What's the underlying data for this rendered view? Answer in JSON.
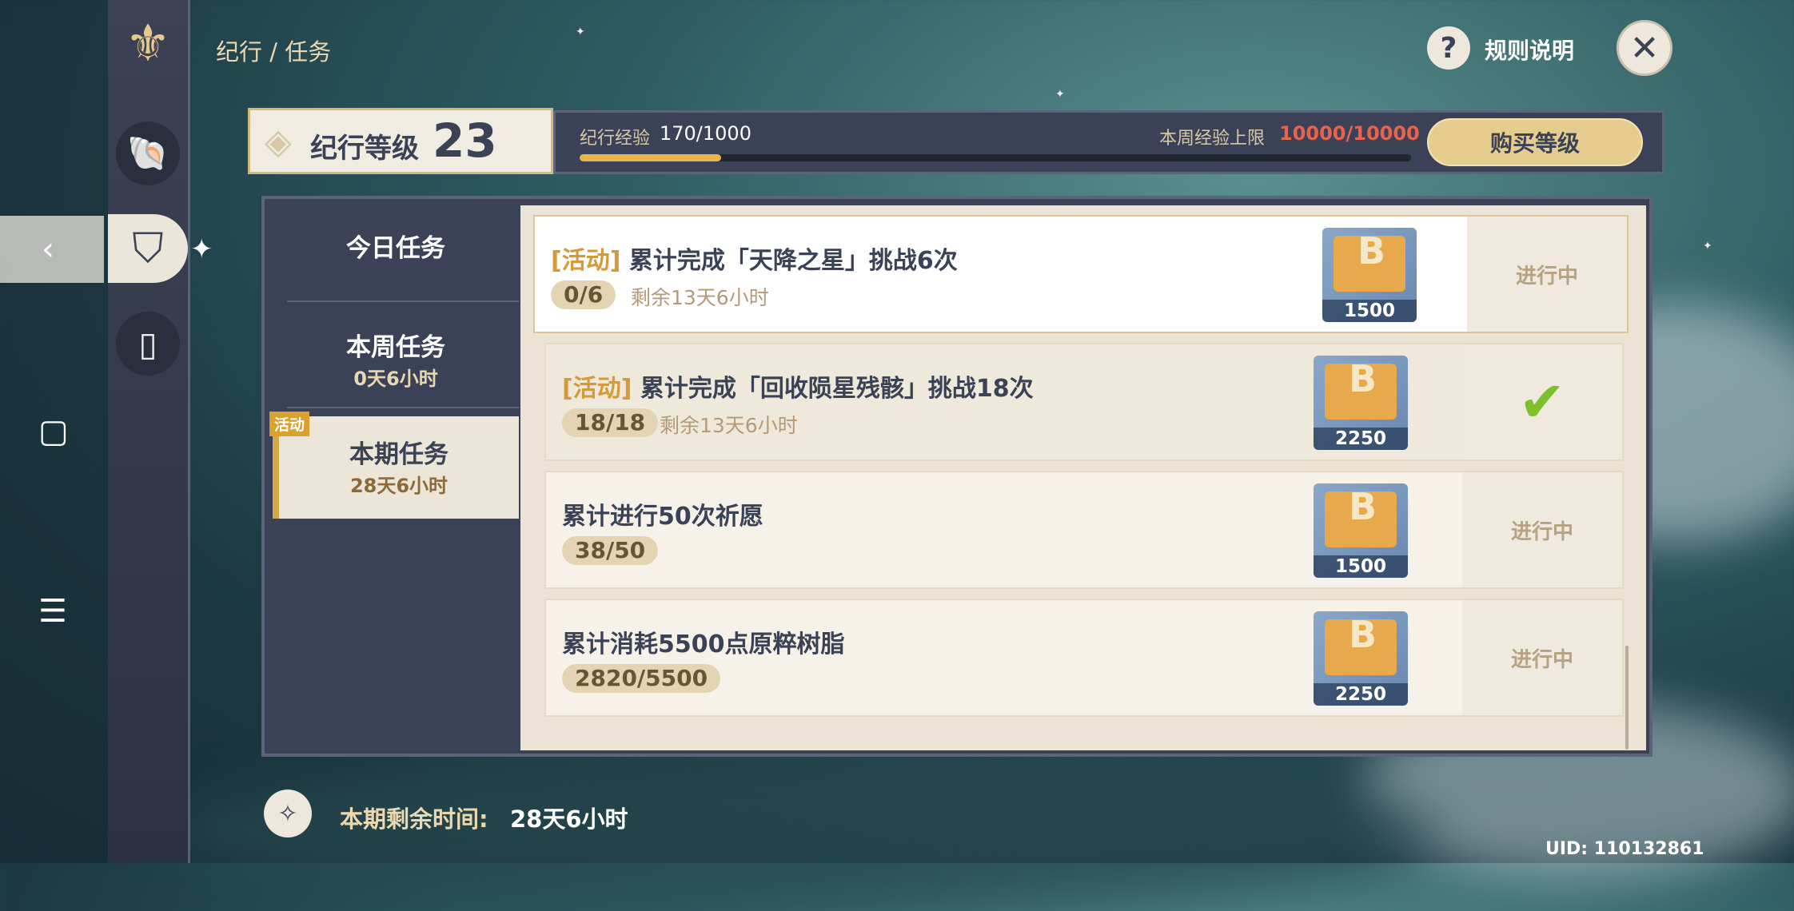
{
  "breadcrumb": "纪行 / 任务",
  "help": {
    "icon": "?",
    "label": "规则说明"
  },
  "close": {
    "icon": "✕"
  },
  "level": {
    "label": "纪行等级",
    "value": "23"
  },
  "xp": {
    "label": "纪行经验",
    "value": "170/1000",
    "progress": 0.17
  },
  "weekly_cap": {
    "label": "本周经验上限",
    "value": "10000/10000"
  },
  "buy_button": "购买等级",
  "tabs": [
    {
      "title": "今日任务",
      "sub": ""
    },
    {
      "title": "本周任务",
      "sub": "0天6小时"
    },
    {
      "title": "本期任务",
      "sub": "28天6小时",
      "badge": "活动",
      "active": true
    }
  ],
  "tasks": [
    {
      "tag": "[活动]",
      "title": "累计完成「天降之星」挑战6次",
      "progress": "0/6",
      "remain": "剩余13天6小时",
      "reward": "1500",
      "status": "进行中",
      "done": false
    },
    {
      "tag": "[活动]",
      "title": "累计完成「回收陨星残骸」挑战18次",
      "progress": "18/18",
      "remain": "剩余13天6小时",
      "reward": "2250",
      "status": "",
      "done": true
    },
    {
      "tag": "",
      "title": "累计进行50次祈愿",
      "progress": "38/50",
      "remain": "",
      "reward": "1500",
      "status": "进行中",
      "done": false
    },
    {
      "tag": "",
      "title": "累计消耗5500点原粹树脂",
      "progress": "2820/5500",
      "remain": "",
      "reward": "2250",
      "status": "进行中",
      "done": false
    }
  ],
  "reward_icon_text": "B",
  "check_icon": "✔",
  "bottom": {
    "label": "本期剩余时间:",
    "value": "28天6小时"
  },
  "uid": "UID: 110132861",
  "colors": {
    "accent": "#d49a3a",
    "warning": "#e8634d",
    "xp_fill": "#e8b64b",
    "panel": "#3b4156"
  }
}
